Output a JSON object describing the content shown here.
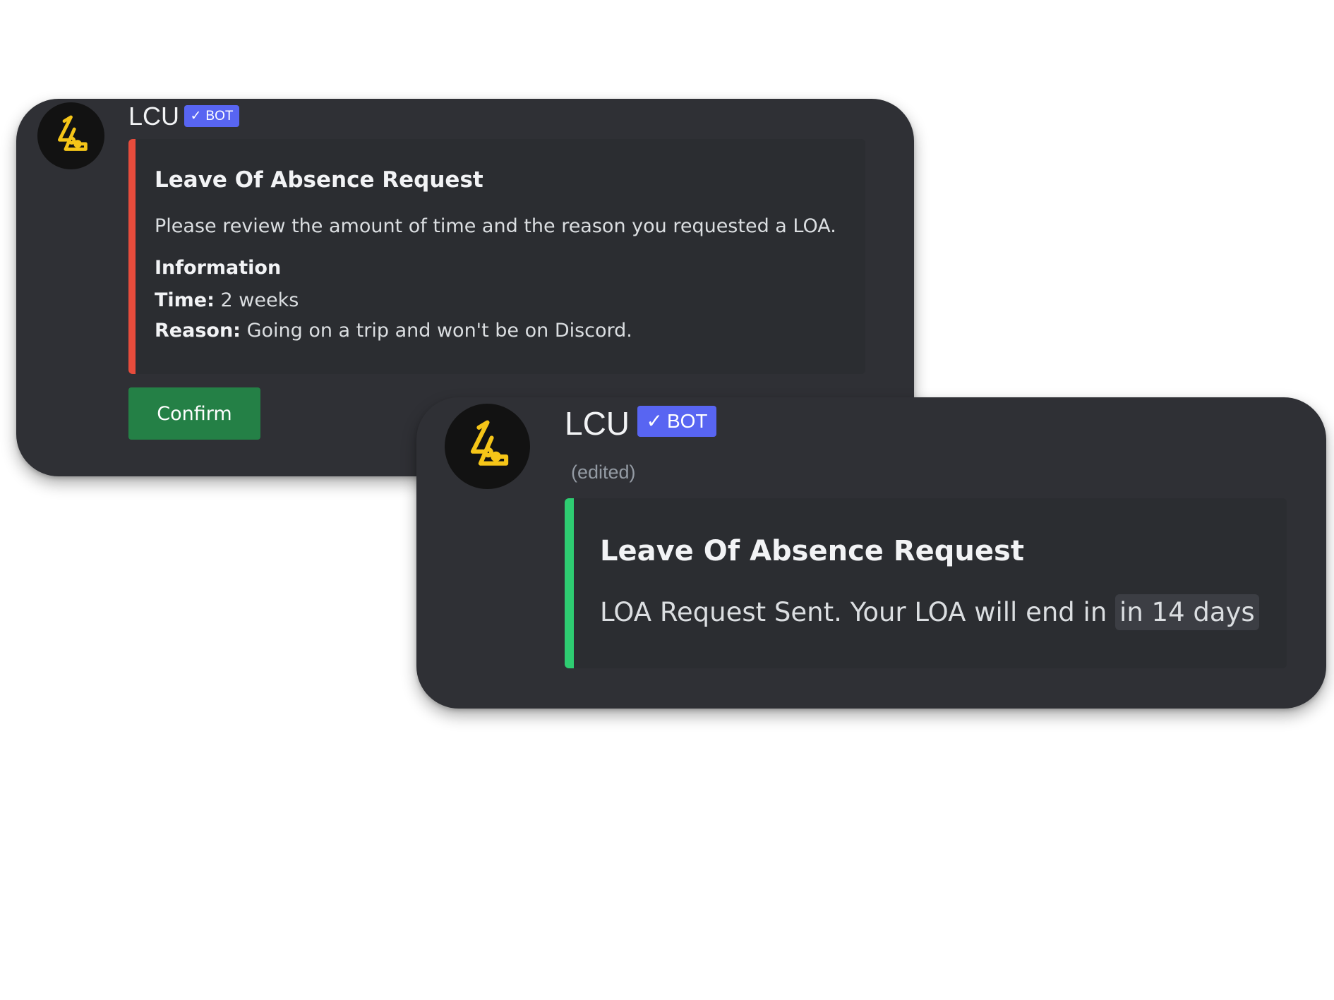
{
  "colors": {
    "card_background": "#2f3035",
    "embed_background": "#2b2d31",
    "bot_badge": "#5865f2",
    "request_accent": "#e74c3c",
    "sent_accent": "#2ecc71",
    "confirm_button": "#248046",
    "avatar_logo": "#f5c518"
  },
  "message_request": {
    "author": "LCU",
    "bot_badge": {
      "icon": "check-icon",
      "check_glyph": "✓",
      "label": "BOT"
    },
    "avatar_icon": "lcu-logo-icon",
    "embed": {
      "title": "Leave Of Absence Request",
      "description": "Please review the amount of time and the reason you requested a LOA.",
      "field_name": "Information",
      "time_label": "Time:",
      "time_value": "2 weeks",
      "reason_label": "Reason:",
      "reason_value": "Going on a trip and won't be on Discord."
    },
    "confirm_label": "Confirm"
  },
  "message_sent": {
    "author": "LCU",
    "bot_badge": {
      "icon": "check-icon",
      "check_glyph": "✓",
      "label": "BOT"
    },
    "avatar_icon": "lcu-logo-icon",
    "edited_label": "(edited)",
    "embed": {
      "title": "Leave Of Absence Request",
      "description": "LOA Request Sent. Your LOA will end in",
      "end_time": "in 14 days"
    }
  }
}
